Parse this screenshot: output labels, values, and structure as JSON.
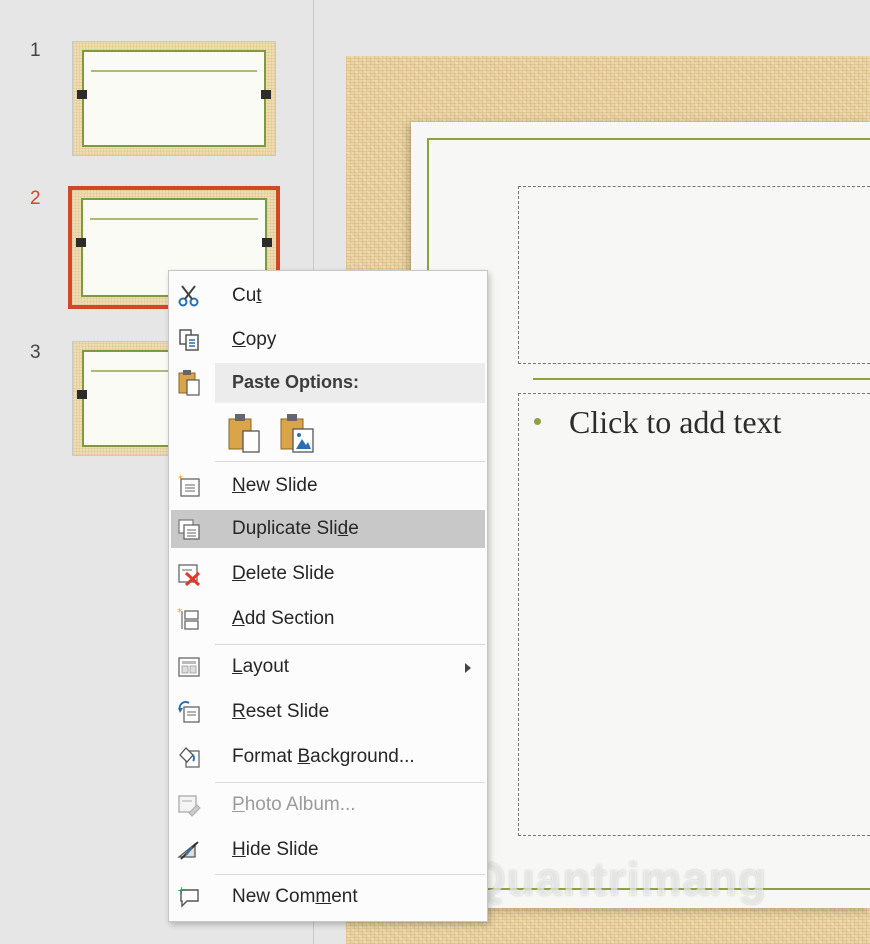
{
  "thumbnails": [
    {
      "number": "1",
      "selected": false
    },
    {
      "number": "2",
      "selected": true
    },
    {
      "number": "3",
      "selected": false
    }
  ],
  "slide": {
    "content_placeholder": "Click to add text"
  },
  "watermark": "Quantrimang",
  "context_menu": {
    "cut": {
      "label": "Cut",
      "icon": "scissors-icon"
    },
    "copy": {
      "label": "Copy",
      "icon": "copy-icon"
    },
    "paste_options": {
      "label": "Paste Options:",
      "icon": "clipboard-icon"
    },
    "paste_buttons": [
      {
        "name": "use-destination-theme",
        "icon": "paste-keep-icon"
      },
      {
        "name": "picture",
        "icon": "paste-picture-icon"
      }
    ],
    "new_slide": {
      "label": "New Slide",
      "icon": "new-slide-icon"
    },
    "duplicate_slide": {
      "label": "Duplicate Slide",
      "icon": "duplicate-slide-icon",
      "highlighted": true
    },
    "delete_slide": {
      "label": "Delete Slide",
      "icon": "delete-slide-icon"
    },
    "add_section": {
      "label": "Add Section",
      "icon": "add-section-icon"
    },
    "layout": {
      "label": "Layout",
      "icon": "layout-icon",
      "has_submenu": true
    },
    "reset_slide": {
      "label": "Reset Slide",
      "icon": "reset-slide-icon"
    },
    "format_background": {
      "label": "Format Background...",
      "icon": "format-background-icon"
    },
    "photo_album": {
      "label": "Photo Album...",
      "icon": "photo-album-icon",
      "disabled": true
    },
    "hide_slide": {
      "label": "Hide Slide",
      "icon": "hide-slide-icon"
    },
    "new_comment": {
      "label": "New Comment",
      "icon": "new-comment-icon"
    }
  },
  "colors": {
    "selection_accent": "#d24726",
    "theme_green": "#8aa23f",
    "menu_hover": "#c8c8c8",
    "delete_red": "#e0392b"
  }
}
